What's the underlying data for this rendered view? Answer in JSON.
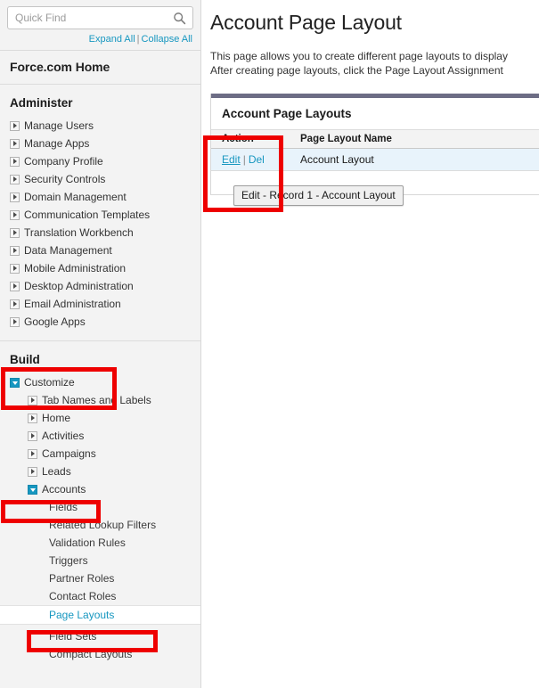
{
  "sidebar": {
    "quick_find": {
      "placeholder": "Quick Find",
      "value": "",
      "icon": "search-icon"
    },
    "expand_all_label": "Expand All",
    "collapse_all_label": "Collapse All",
    "separator": "|",
    "force_home_label": "Force.com Home",
    "sections": [
      {
        "title": "Administer",
        "items": [
          {
            "label": "Manage Users",
            "state": "collapsed",
            "level": 1
          },
          {
            "label": "Manage Apps",
            "state": "collapsed",
            "level": 1
          },
          {
            "label": "Company Profile",
            "state": "collapsed",
            "level": 1
          },
          {
            "label": "Security Controls",
            "state": "collapsed",
            "level": 1
          },
          {
            "label": "Domain Management",
            "state": "collapsed",
            "level": 1
          },
          {
            "label": "Communication Templates",
            "state": "collapsed",
            "level": 1
          },
          {
            "label": "Translation Workbench",
            "state": "collapsed",
            "level": 1
          },
          {
            "label": "Data Management",
            "state": "collapsed",
            "level": 1
          },
          {
            "label": "Mobile Administration",
            "state": "collapsed",
            "level": 1
          },
          {
            "label": "Desktop Administration",
            "state": "collapsed",
            "level": 1
          },
          {
            "label": "Email Administration",
            "state": "collapsed",
            "level": 1
          },
          {
            "label": "Google Apps",
            "state": "collapsed",
            "level": 1
          }
        ]
      },
      {
        "title": "Build",
        "items": [
          {
            "label": "Customize",
            "state": "expanded",
            "level": 1
          },
          {
            "label": "Tab Names and Labels",
            "state": "collapsed",
            "level": 2
          },
          {
            "label": "Home",
            "state": "collapsed",
            "level": 2
          },
          {
            "label": "Activities",
            "state": "collapsed",
            "level": 2
          },
          {
            "label": "Campaigns",
            "state": "collapsed",
            "level": 2
          },
          {
            "label": "Leads",
            "state": "collapsed",
            "level": 2
          },
          {
            "label": "Accounts",
            "state": "expanded",
            "level": 2
          },
          {
            "label": "Fields",
            "state": "none",
            "level": 3
          },
          {
            "label": "Related Lookup Filters",
            "state": "none",
            "level": 3
          },
          {
            "label": "Validation Rules",
            "state": "none",
            "level": 3
          },
          {
            "label": "Triggers",
            "state": "none",
            "level": 3
          },
          {
            "label": "Partner Roles",
            "state": "none",
            "level": 3
          },
          {
            "label": "Contact Roles",
            "state": "none",
            "level": 3
          },
          {
            "label": "Page Layouts",
            "state": "none",
            "level": 3,
            "active": true
          },
          {
            "label": "Field Sets",
            "state": "none",
            "level": 3
          },
          {
            "label": "Compact Layouts",
            "state": "none",
            "level": 3
          }
        ]
      }
    ]
  },
  "main": {
    "title": "Account Page Layout",
    "description_line1": "This page allows you to create different page layouts to display",
    "description_line2": "After creating page layouts, click the Page Layout Assignment",
    "panel": {
      "title": "Account Page Layouts",
      "columns": [
        "Action",
        "Page Layout Name"
      ],
      "rows": [
        {
          "edit_label": "Edit",
          "action_separator": "|",
          "delete_label": "Del",
          "page_layout_name": "Account Layout"
        }
      ]
    },
    "tooltip": "Edit - Record 1 - Account Layout"
  },
  "annotations": {
    "highlight_color": "#ee0000",
    "boxes": [
      {
        "name": "action-column-highlight"
      },
      {
        "name": "build-customize-highlight"
      },
      {
        "name": "accounts-highlight"
      },
      {
        "name": "page-layouts-highlight"
      }
    ]
  }
}
